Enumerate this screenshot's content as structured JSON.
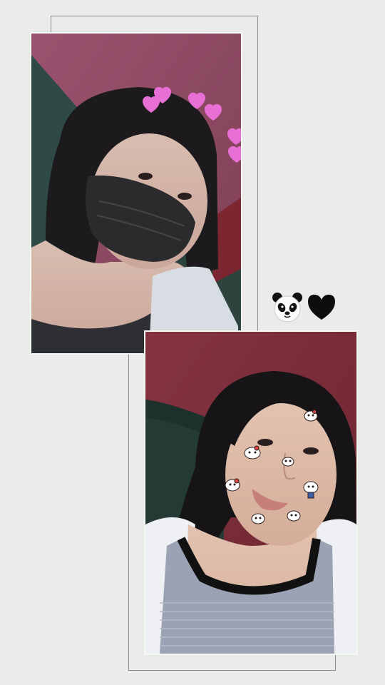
{
  "stickers": [
    {
      "icon": "panda-face-icon"
    },
    {
      "icon": "black-heart-icon"
    }
  ],
  "photos": [
    {
      "subject": "selfie-masked",
      "filter_stickers": "pink-hearts"
    },
    {
      "subject": "selfie-face-stickers",
      "filter_stickers": "cartoon-cat-face-stickers"
    }
  ],
  "colors": {
    "background": "#ebebeb",
    "frame_line": "#8a8a8a",
    "wall_top": "#8e4a63",
    "wall_bottom": "#7a2c37",
    "hearts": "#e86fd6"
  }
}
